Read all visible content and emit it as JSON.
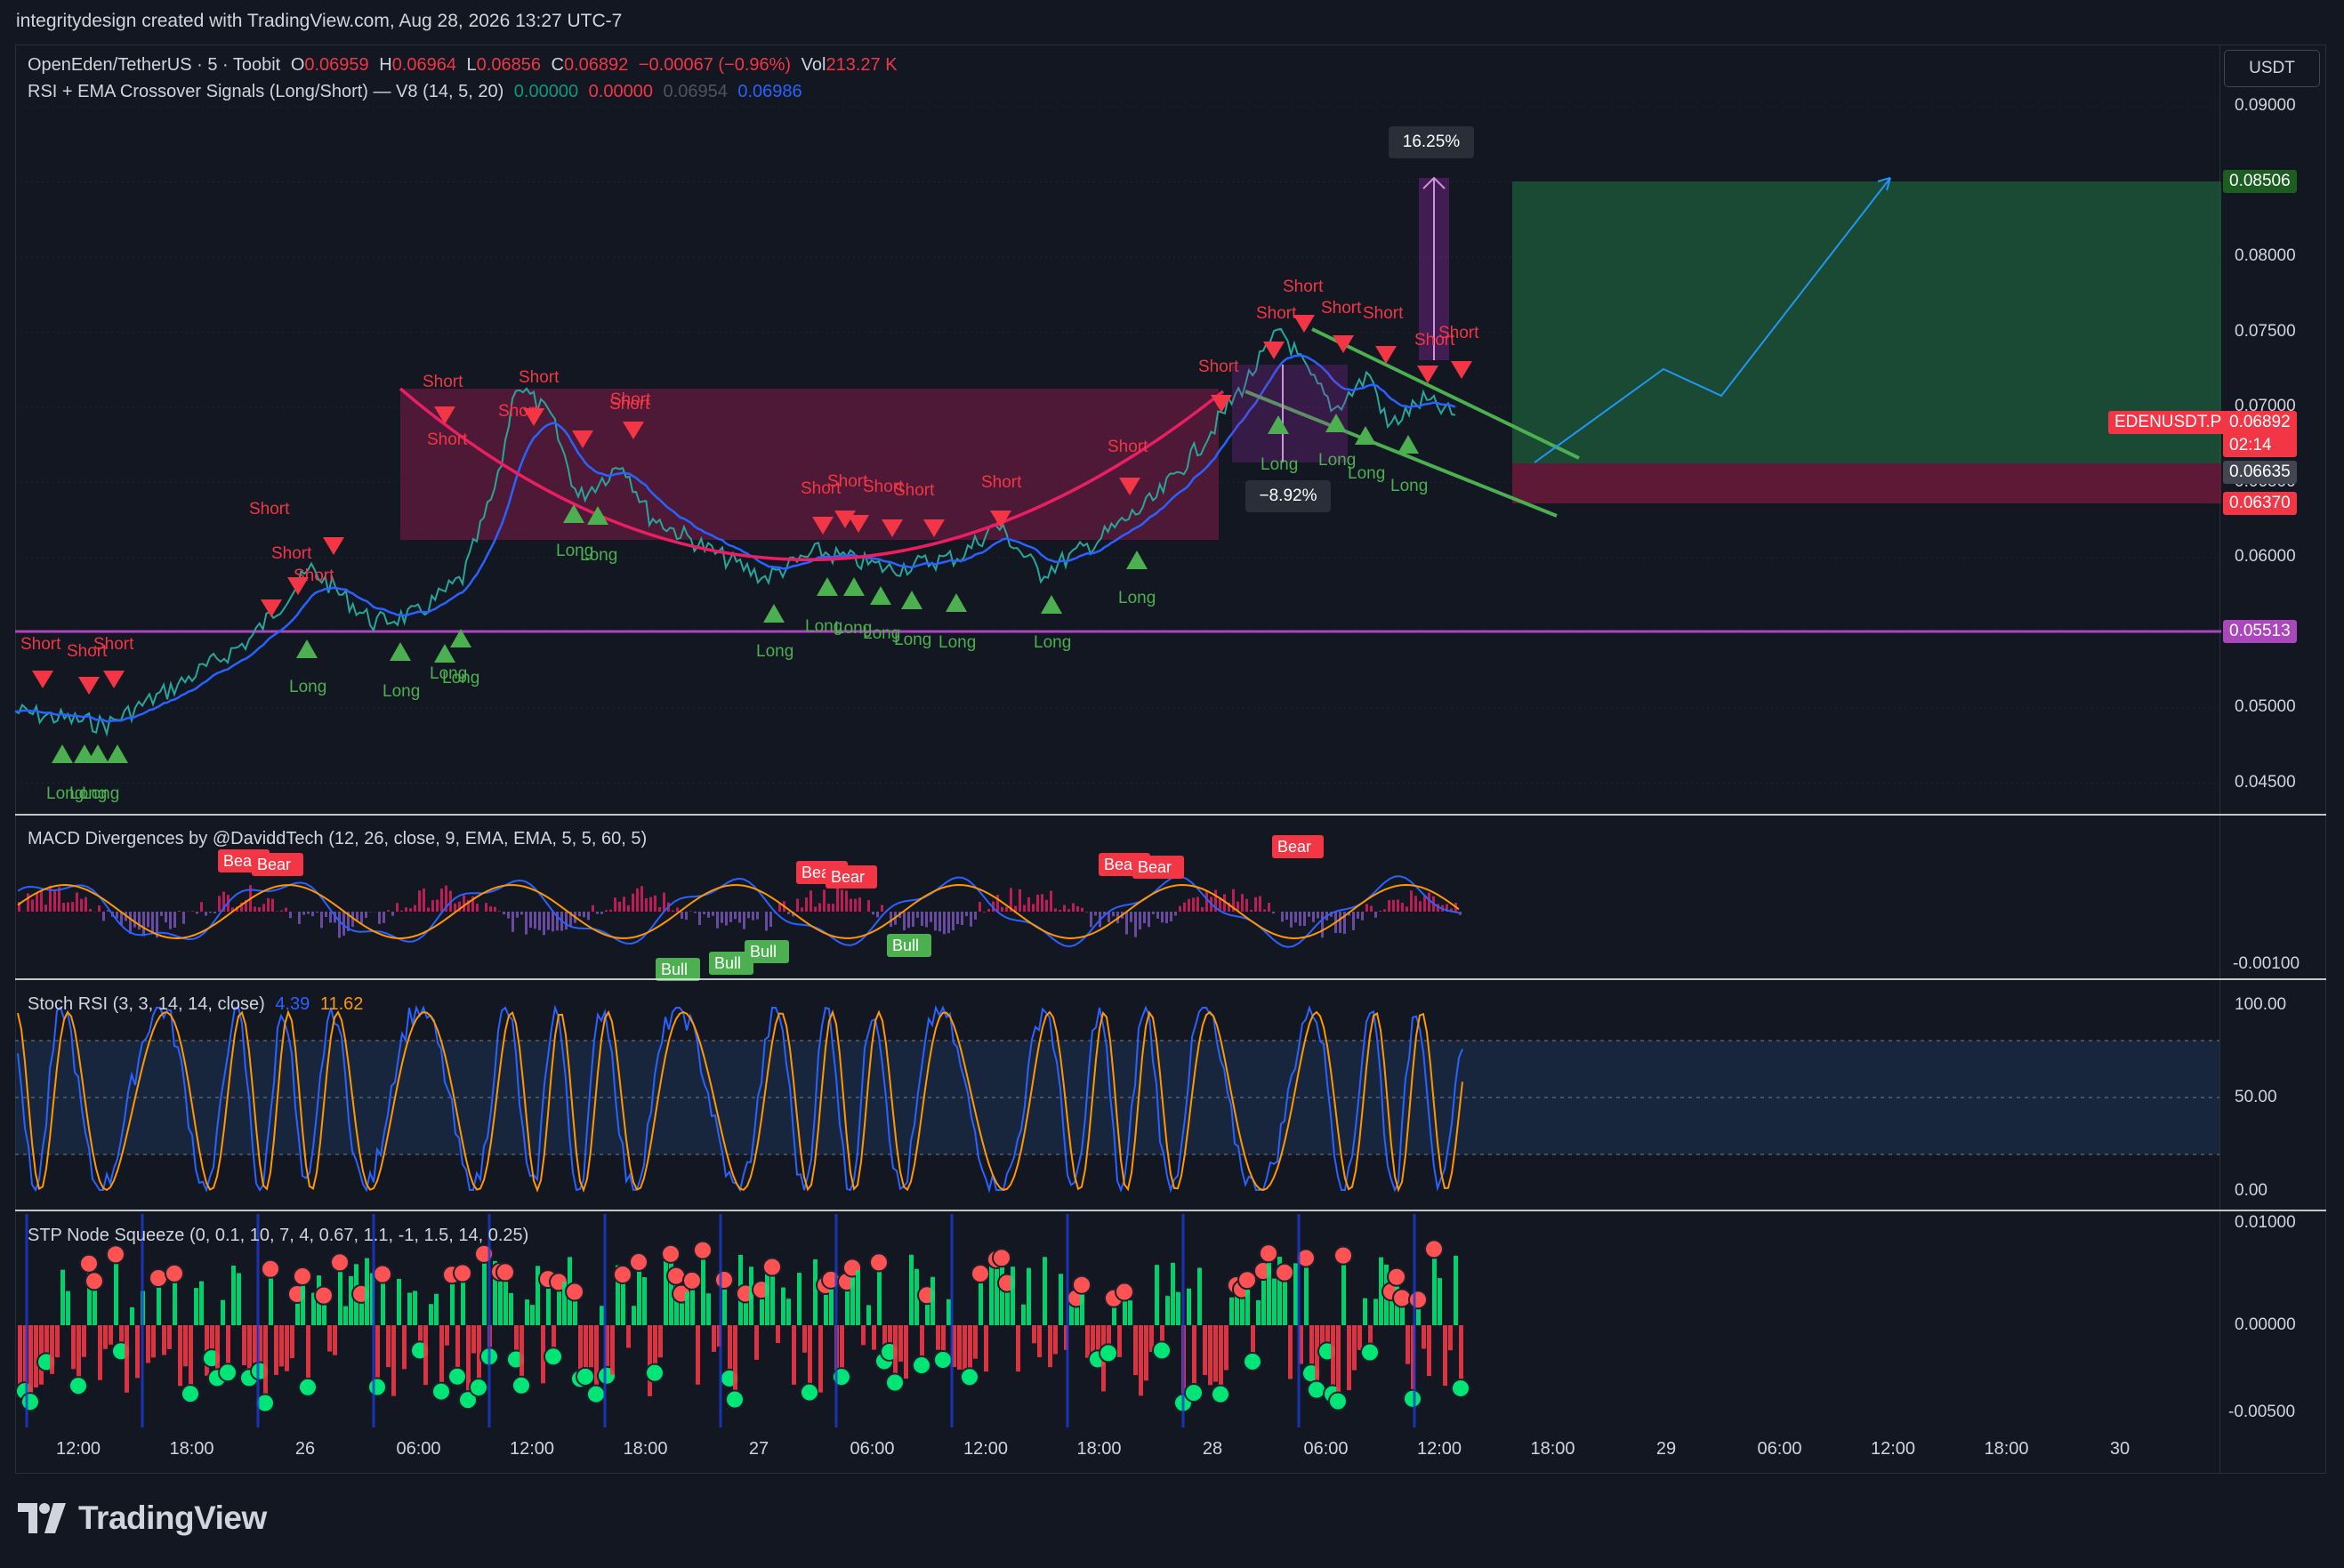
{
  "credit": "integritydesign created with TradingView.com, Aug 28, 2026 13:27 UTC-7",
  "main_legend": {
    "symbol": "OpenEden/TetherUS · 5 · Toobit",
    "open_label": "O",
    "open": "0.06959",
    "high_label": "H",
    "high": "0.06964",
    "low_label": "L",
    "low": "0.06856",
    "close_label": "C",
    "close": "0.06892",
    "change": "−0.00067 (−0.96%)",
    "vol_label": "Vol",
    "vol": "213.27 K"
  },
  "indicator_legend": {
    "name": "RSI + EMA Crossover Signals (Long/Short) — V8 (14, 5, 20)",
    "v1": "0.00000",
    "v2": "0.00000",
    "v3": "0.06954",
    "v4": "0.06986"
  },
  "macd_legend": "MACD Divergences by @DaviddTech (12, 26, close, 9, EMA, EMA, 5, 5, 60, 5)",
  "stoch_legend": {
    "name": "Stoch RSI (3, 3, 14, 14, close)",
    "k": "4.39",
    "d": "11.62"
  },
  "stp_legend": "STP Node Squeeze (0, 0.1, 10, 7, 4, 0.67, 1.1, -1, 1.5, 14, 0.25)",
  "currency": "USDT",
  "price_axis": [
    "0.09000",
    "0.08500",
    "0.08000",
    "0.07500",
    "0.07000",
    "0.06500",
    "0.06000",
    "0.05500",
    "0.05000",
    "0.04500"
  ],
  "macd_axis": [
    "-0.00100"
  ],
  "stoch_axis": [
    "100.00",
    "50.00",
    "0.00"
  ],
  "stp_axis": [
    "0.01000",
    "0.00000",
    "-0.00500"
  ],
  "time_axis": [
    "12:00",
    "18:00",
    "26",
    "06:00",
    "12:00",
    "18:00",
    "27",
    "06:00",
    "12:00",
    "18:00",
    "28",
    "06:00",
    "12:00",
    "18:00",
    "29",
    "06:00",
    "12:00",
    "18:00",
    "30"
  ],
  "price_tags": {
    "target": "0.08506",
    "symbol_name": "EDENUSDT.P",
    "last": "0.06892",
    "countdown": "02:14",
    "entry": "0.06635",
    "stop": "0.06370",
    "support": "0.05513"
  },
  "measure_up": "16.25%",
  "measure_down": "−8.92%",
  "signal_text": {
    "long": "Long",
    "short": "Short",
    "bull": "Bull",
    "bear": "Bear"
  },
  "logo": "TradingView",
  "colors": {
    "background": "#131722",
    "up": "#26a69a",
    "down": "#ef5350",
    "long_signal": "#4caf50",
    "short_signal": "#f23645",
    "ema": "#2962ff",
    "support": "#ab47bc",
    "cup_zone": "#801c47",
    "target_zone": "#1e5c3a",
    "stop_zone": "#6b1a3a"
  }
}
